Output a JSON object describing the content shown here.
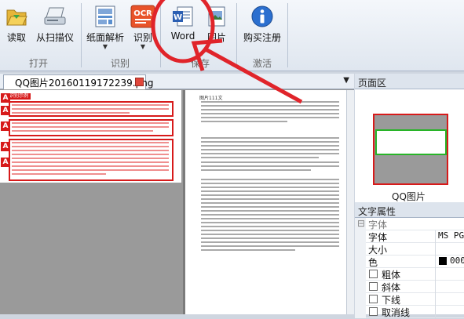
{
  "ribbon": {
    "buttons": [
      {
        "label": "读取",
        "icon": "folder-open-icon",
        "arrow": false
      },
      {
        "label": "从扫描仪",
        "icon": "scanner-icon",
        "arrow": false
      },
      {
        "label": "纸面解析",
        "icon": "page-analysis-icon",
        "arrow": true
      },
      {
        "label": "识别",
        "icon": "ocr-icon",
        "arrow": true
      },
      {
        "label": "Word",
        "icon": "word-document-icon",
        "arrow": false
      },
      {
        "label": "图片",
        "icon": "image-export-icon",
        "arrow": false
      },
      {
        "label": "购买注册",
        "icon": "info-icon",
        "arrow": false
      }
    ],
    "groups": {
      "open": "打开",
      "recognize": "识别",
      "save": "保存",
      "activate": "激活"
    },
    "ocr_text": "OCR"
  },
  "document": {
    "tab_title": "QQ图片20160119172239.png",
    "image_title": "识别示例",
    "text_title": "图片111文"
  },
  "pane": {
    "page_area": "页面区",
    "thumb_label": "QQ图片",
    "text_props": "文字属性"
  },
  "props": {
    "group": "字体",
    "rows": [
      {
        "name": "字体",
        "value": "MS PGothic",
        "checkbox": false
      },
      {
        "name": "大小",
        "value": "",
        "checkbox": false
      },
      {
        "name": "色",
        "value": "000",
        "checkbox": false,
        "swatch": "#000000"
      },
      {
        "name": "粗体",
        "value": "",
        "checkbox": true
      },
      {
        "name": "斜体",
        "value": "",
        "checkbox": true
      },
      {
        "name": "下线",
        "value": "",
        "checkbox": true
      },
      {
        "name": "取消线",
        "value": "",
        "checkbox": true
      }
    ]
  },
  "colors": {
    "annotation": "#e0242a",
    "block_border": "#d71a1a",
    "thumb_highlight": "#28b428"
  }
}
